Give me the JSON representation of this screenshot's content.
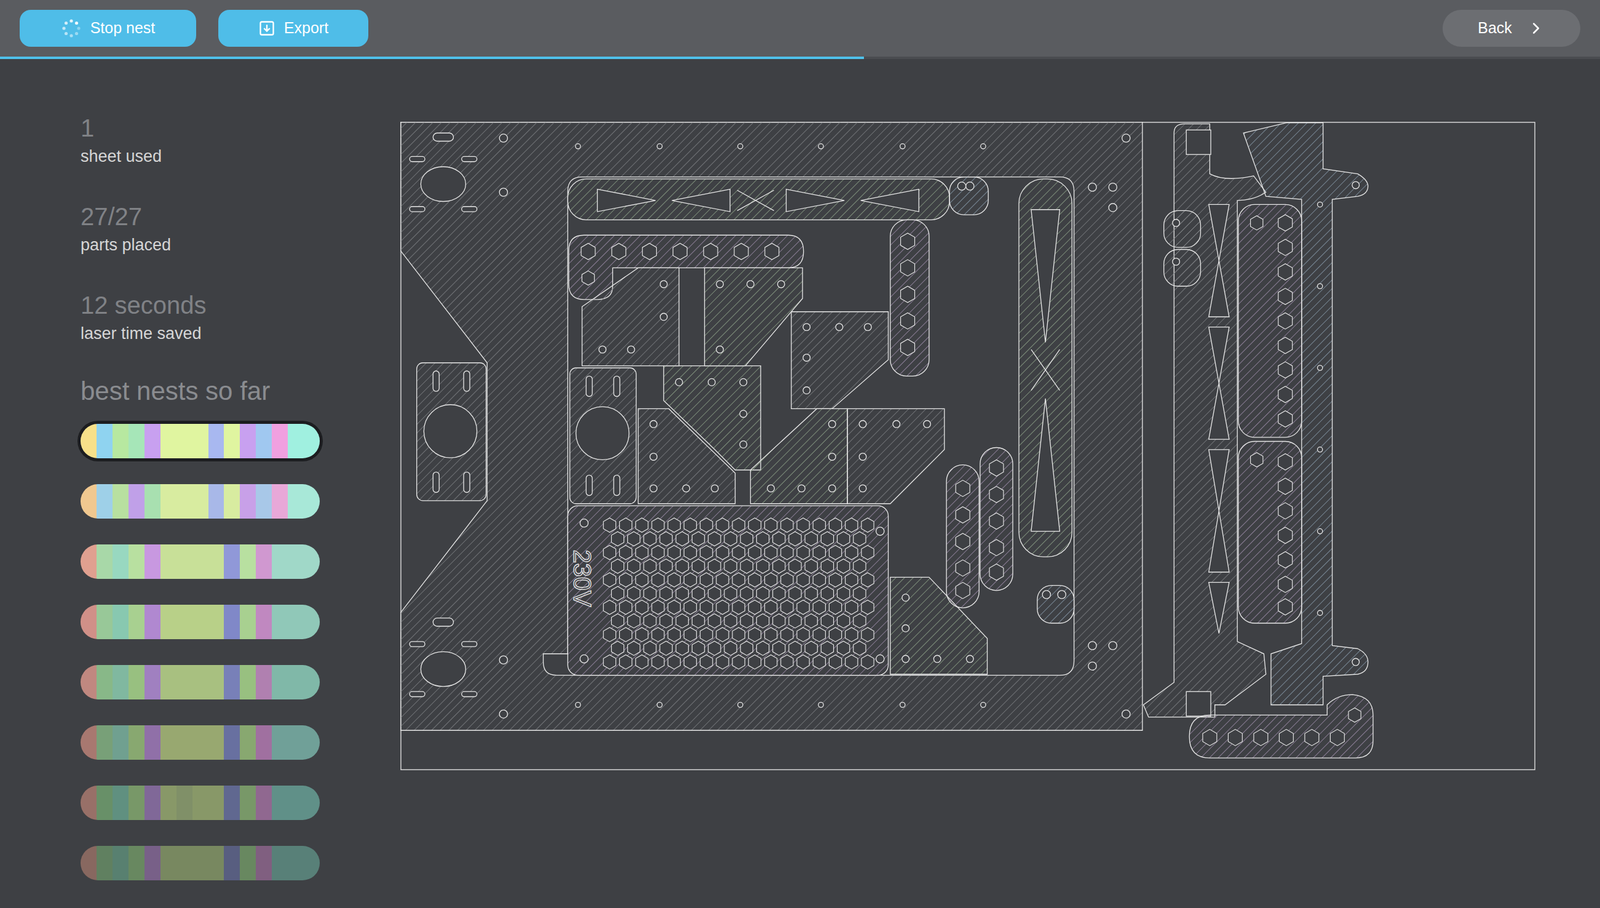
{
  "toolbar": {
    "buttons": [
      {
        "label": "Stop nest"
      },
      {
        "label": "Export"
      }
    ],
    "back_button": {
      "label": "Back"
    }
  },
  "progress": {
    "level": 0.54
  },
  "stats": [
    {
      "value": "1",
      "label": "sheet used"
    },
    {
      "value": "27/27",
      "label": "parts placed"
    },
    {
      "value": "12 seconds",
      "label": "laser time saved"
    }
  ],
  "nests": {
    "title": "best nests so far",
    "items": [
      {
        "selected": true,
        "stripes": [
          "#f7e08a",
          "#8fd3f0",
          "#b7e8a0",
          "#a6e6b8",
          "#c8a0f0",
          "#e0f5a0",
          "#e0f5a0",
          "#e0f5a0",
          "#a8b8f0",
          "#e0f5a0",
          "#c8a0f0",
          "#a0c8f0",
          "#f0a0e0",
          "#a0f0e0",
          "#a0f0e0"
        ]
      },
      {
        "selected": false,
        "stripes": [
          "#f0c890",
          "#9ed0e8",
          "#b8e0a0",
          "#c0a0e8",
          "#a8e0b0",
          "#d8eca0",
          "#d8eca0",
          "#d8eca0",
          "#a8b8e8",
          "#d8eca0",
          "#c8a0e8",
          "#a8c8e8",
          "#e8a8d8",
          "#a8e8d8",
          "#a8e8d8"
        ]
      },
      {
        "selected": false,
        "stripes": [
          "#e0a090",
          "#a8d8a8",
          "#98d8c0",
          "#b8e0a0",
          "#c898e0",
          "#c8e098",
          "#c8e098",
          "#c8e098",
          "#c8e098",
          "#9098d8",
          "#b8e0a0",
          "#d098d0",
          "#a0d8c8",
          "#a0d8c8",
          "#a0d8c8"
        ]
      },
      {
        "selected": false,
        "stripes": [
          "#d09088",
          "#98c898",
          "#88c8b0",
          "#a8d090",
          "#b088d0",
          "#b8d088",
          "#b8d088",
          "#b8d088",
          "#b8d088",
          "#8088c8",
          "#a8d090",
          "#c088c0",
          "#90c8b8",
          "#90c8b8",
          "#90c8b8"
        ]
      },
      {
        "selected": false,
        "stripes": [
          "#c08880",
          "#88b888",
          "#80b8a0",
          "#98c080",
          "#a080c0",
          "#a8c080",
          "#a8c080",
          "#a8c080",
          "#a8c080",
          "#7880b8",
          "#98c080",
          "#b080b0",
          "#80b8a8",
          "#80b8a8",
          "#80b8a8"
        ]
      },
      {
        "selected": false,
        "stripes": [
          "#a87870",
          "#78a078",
          "#70a090",
          "#88a870",
          "#9070a8",
          "#98a870",
          "#98a870",
          "#98a870",
          "#98a870",
          "#6870a0",
          "#88a870",
          "#a070a0",
          "#70a098",
          "#70a098",
          "#70a098"
        ]
      },
      {
        "selected": false,
        "stripes": [
          "#987068",
          "#689068",
          "#609080",
          "#789868",
          "#806898",
          "#889868",
          "#809068",
          "#889868",
          "#889868",
          "#606890",
          "#789868",
          "#906890",
          "#609088",
          "#609088",
          "#609088"
        ]
      },
      {
        "selected": false,
        "stripes": [
          "#886860",
          "#608060",
          "#588070",
          "#688860",
          "#786088",
          "#788860",
          "#788860",
          "#788860",
          "#788860",
          "#585e80",
          "#688860",
          "#805f80",
          "#588078",
          "#588078",
          "#588078"
        ]
      }
    ]
  },
  "nest_view": {
    "engraving": "230V"
  }
}
